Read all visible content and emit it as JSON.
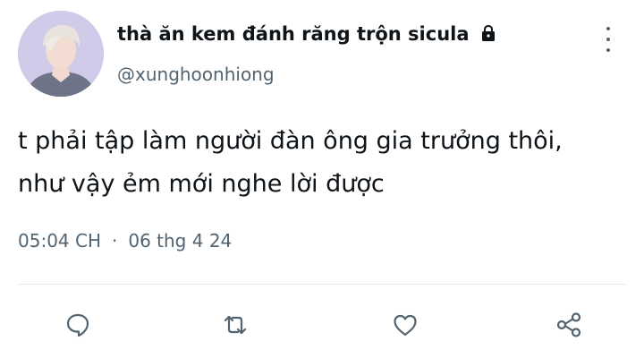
{
  "user": {
    "display_name": "thà ăn kem đánh răng trộn sicula",
    "handle": "@xunghoonhiong",
    "protected_icon": "lock-icon",
    "avatar_icon": "profile-photo"
  },
  "tweet": {
    "text_lines": [
      "t phải tập làm người đàn ông gia trưởng thôi,",
      "như vậy ẻm mới nghe lời được"
    ],
    "time": "05:04 CH",
    "separator": "·",
    "date": "06 thg 4 24"
  },
  "actions": [
    {
      "name": "reply",
      "icon": "reply-icon"
    },
    {
      "name": "retweet",
      "icon": "retweet-icon"
    },
    {
      "name": "like",
      "icon": "heart-icon"
    },
    {
      "name": "share",
      "icon": "share-icon"
    }
  ],
  "colors": {
    "text": "#0f1419",
    "secondary": "#536471",
    "divider": "#e6e9eb",
    "background": "#ffffff"
  }
}
